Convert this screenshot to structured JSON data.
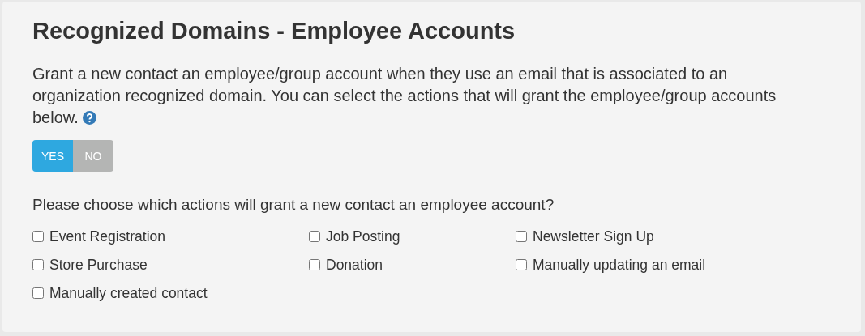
{
  "title": "Recognized Domains - Employee Accounts",
  "description": "Grant a new contact an employee/group account when they use an email that is associated to an organization recognized domain. You can select the actions that will grant the employee/group accounts below.",
  "toggle": [
    {
      "label": "YES",
      "selected": true
    },
    {
      "label": "NO",
      "selected": false
    }
  ],
  "question": "Please choose which actions will grant a new contact an employee account?",
  "actions": [
    {
      "label": "Event Registration",
      "checked": false
    },
    {
      "label": "Job Posting",
      "checked": false
    },
    {
      "label": "Newsletter Sign Up",
      "checked": false
    },
    {
      "label": "Store Purchase",
      "checked": false
    },
    {
      "label": "Donation",
      "checked": false
    },
    {
      "label": "Manually updating an email",
      "checked": false
    },
    {
      "label": "Manually created contact",
      "checked": false
    }
  ]
}
